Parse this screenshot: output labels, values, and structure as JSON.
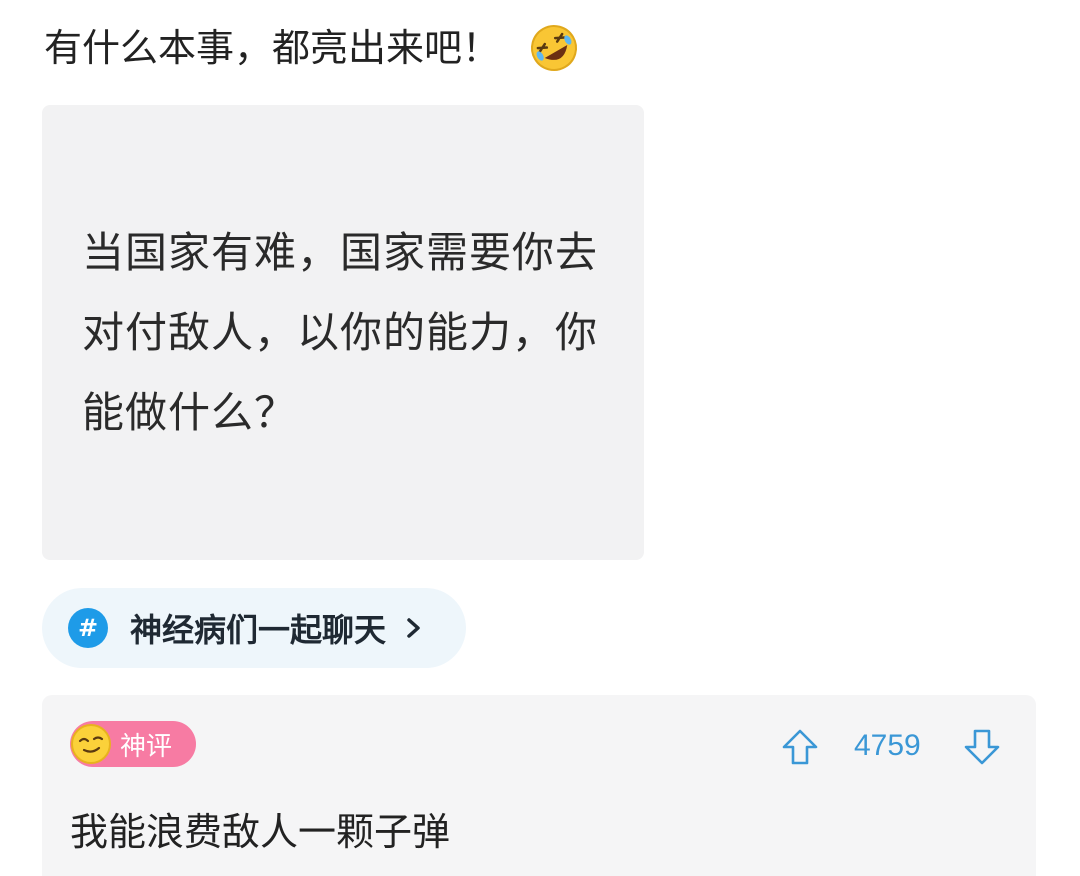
{
  "post": {
    "title": "有什么本事，都亮出来吧！",
    "title_emoji": "rolling-on-floor-laughing-icon"
  },
  "quote_image": {
    "text": "当国家有难，国家需要你去对付敌人，以你的能力，你能做什么？"
  },
  "topic": {
    "icon": "#",
    "label": "神经病们一起聊天",
    "chevron": "chevron-right-icon"
  },
  "god_comment": {
    "badge_label": "神评",
    "upvotes": "4759",
    "text": "我能浪费敌人一颗子弹"
  },
  "colors": {
    "accent_blue": "#1e9be8",
    "vote_blue": "#3a97d6",
    "badge_pink": "#f77ba3",
    "card_gray": "#f2f2f3",
    "chip_bg": "#eef6fb"
  }
}
